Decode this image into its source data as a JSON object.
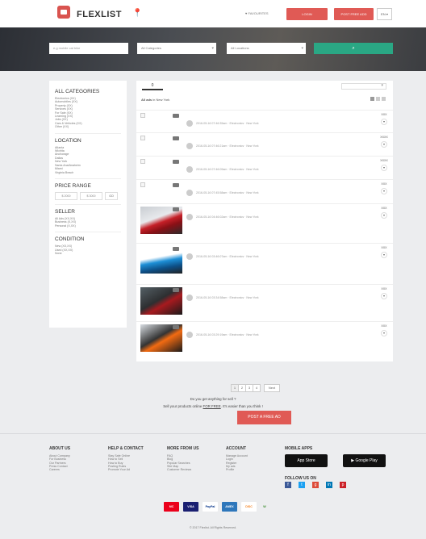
{
  "header": {
    "logo_text": "FLEXLIST",
    "favourites": "♥ FAVOURITES",
    "login_label": "LOGIN",
    "post_label": "POST FREE ADD",
    "language": "EN"
  },
  "search": {
    "keyword_placeholder": "e.g mobile cat bike",
    "category_value": "All Categories",
    "location_value": "All Locations",
    "search_icon": "search-icon"
  },
  "sidebar": {
    "categories_title": "ALL CATEGORIES",
    "categories": [
      "Electronics (XX)",
      "Automobiles (XX)",
      "Property (XX)",
      "Services (XX)",
      "For Sale (XX)",
      "Learning (XX)",
      "Jobs (XX)",
      "Cars & Vehicles (XX)",
      "Other (XX)"
    ],
    "location_title": "LOCATION",
    "locations": [
      "Atlanta",
      "Wichita",
      "Anchorage",
      "Dallas",
      "New York",
      "Santa Ana/Anaheim",
      "Miami",
      "Virginia Beach"
    ],
    "price_title": "PRICE RANGE",
    "price_min": "$ 2000",
    "price_max": "$ 3000",
    "go_label": "GO",
    "seller_title": "SELLER",
    "seller_items": [
      "All Ads (XX,XX)",
      "Business (X,XX)",
      "Personal (X,XX)"
    ],
    "condition_title": "CONDITION",
    "condition_items": [
      "New (XX,XX)",
      "Used (XX,XX)",
      "None"
    ]
  },
  "listing": {
    "tab_active": "0",
    "tab_other": "",
    "sort_value": "",
    "crumb_bold": "All ads",
    "crumb_rest": "in New York",
    "ads": [
      {
        "meta": "2016-05-16 07:46:35am · Electronics · New York",
        "price": "XXX"
      },
      {
        "meta": "2016-05-16 07:46:21am · Electronics · New York",
        "price": "XXXX"
      },
      {
        "meta": "2016-05-16 07:46:09am · Electronics · New York",
        "price": "XXXX"
      },
      {
        "meta": "2016-05-16 07:45:58am · Electronics · New York",
        "price": "XXX"
      },
      {
        "meta": "2016-05-16 04:46:02am · Electronics · New York",
        "price": "XXX"
      },
      {
        "meta": "2016-05-16 03:46:07am · Electronics · New York",
        "price": "XXX"
      },
      {
        "meta": "2016-05-16 03:34:58am · Electronics · New York",
        "price": "XXX"
      },
      {
        "meta": "2016-05-16 03:29:19am · Electronics · New York",
        "price": "XXX"
      }
    ]
  },
  "pagination": {
    "pages": [
      "1",
      "2",
      "3",
      "4"
    ],
    "next": "Next"
  },
  "sell": {
    "question": "Do you get anything for sell ?",
    "subtitle_pre": "Sell your products online",
    "subtitle_link": "FOR FREE",
    "subtitle_post": ". It's easier than you think !",
    "button": "POST A FREE AD"
  },
  "footer": {
    "about_title": "ABOUT US",
    "about_items": [
      "About Company",
      "For Business",
      "Our Partners",
      "Press Contact",
      "Careers"
    ],
    "help_title": "HELP & CONTACT",
    "help_items": [
      "Stay Safe Online",
      "How to Sell",
      "How to Buy",
      "Posting Rules",
      "Promote Your Ad"
    ],
    "more_title": "MORE FROM US",
    "more_items": [
      "FAQ",
      "Blog",
      "Popular Searches",
      "Site Map",
      "Customer Reviews"
    ],
    "account_title": "ACCOUNT",
    "account_items": [
      "Manage Account",
      "Login",
      "Register",
      "My ads",
      "Profile"
    ],
    "mobile_title": "MOBILE APPS",
    "app_store": "App Store",
    "google_play": "Google Play",
    "follow_title": "FOLLOW US ON",
    "payments": [
      "MC",
      "VISA",
      "PayPal",
      "AMEX",
      "DISC",
      "W"
    ],
    "copyright": "© 2017 Flexlist. All Rights Reserved."
  },
  "colors": {
    "accent_red": "#e05a55",
    "search_green": "#2aa784"
  }
}
